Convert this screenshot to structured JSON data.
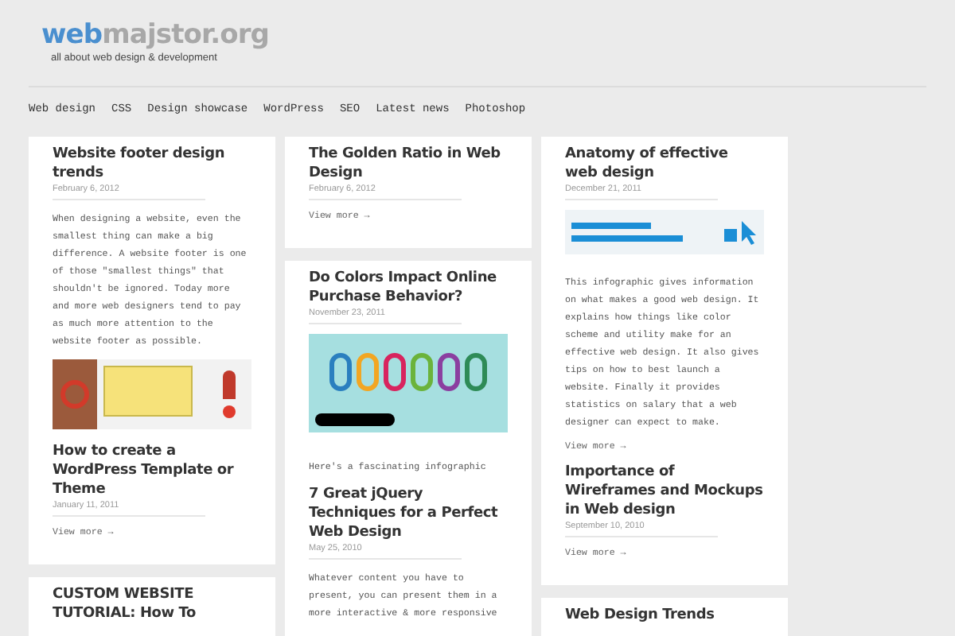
{
  "header": {
    "logo_part_1": "web",
    "logo_part_2": "majstor.org",
    "tagline": "all about web design & development"
  },
  "nav": [
    "Web design",
    "CSS",
    "Design showcase",
    "WordPress",
    "SEO",
    "Latest news",
    "Photoshop"
  ],
  "columns": [
    {
      "cards": [
        {
          "posts": [
            {
              "title": "Website footer design trends",
              "date": "February 6, 2012",
              "excerpt": "When designing a website, even the smallest thing can make a big difference. A website footer is one of those \"smallest things\" that shouldn't be ignored. Today more and more web designers tend to pay as much more attention to the website footer as possible.",
              "kind": "image"
            },
            {
              "title": "How to create a WordPress Template or Theme",
              "date": "January 11, 2011",
              "link": "View more →",
              "kind": "text"
            }
          ]
        },
        {
          "posts": [
            {
              "title": "CUSTOM WEBSITE TUTORIAL: How To",
              "kind": "text"
            }
          ]
        }
      ]
    },
    {
      "cards": [
        {
          "posts": [
            {
              "title": "The Golden Ratio in Web Design",
              "date": "February 6, 2012",
              "link": "View more →",
              "kind": "text"
            }
          ]
        },
        {
          "posts": [
            {
              "title": "Do Colors Impact Online Purchase Behavior?",
              "date": "November 23, 2011",
              "kind": "image",
              "excerpt": "Here's a fascinating infographic"
            },
            {
              "title": "7 Great jQuery Techniques for a Perfect Web Design",
              "date": "May 25, 2010",
              "excerpt": "Whatever content you have to present, you can present them in a more interactive & more responsive",
              "kind": "text"
            }
          ]
        }
      ]
    },
    {
      "cards": [
        {
          "posts": [
            {
              "title": "Anatomy of effective web design",
              "date": "December 21, 2011",
              "kind": "image",
              "excerpt": "This infographic gives information on what makes a good web design. It explains how things like color scheme and utility make for an effective web design. It also gives tips on how to best launch a website. Finally it provides statistics on salary that a web designer can expect to make.",
              "link": "View more →"
            },
            {
              "title": "Importance of Wireframes and Mockups in Web design",
              "date": "September 10, 2010",
              "link": "View more →",
              "kind": "text"
            }
          ]
        },
        {
          "posts": [
            {
              "title": "Web Design Trends",
              "kind": "text"
            }
          ]
        }
      ]
    }
  ]
}
